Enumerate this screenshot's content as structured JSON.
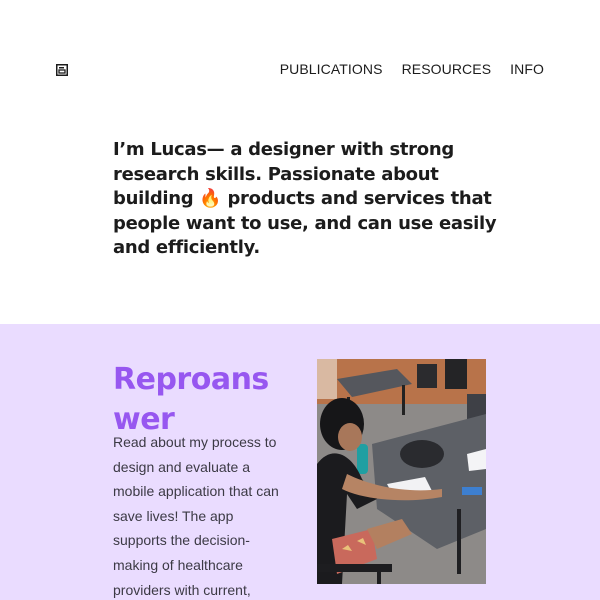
{
  "header": {
    "logo_icon": "square-logo-icon",
    "nav": [
      {
        "label": "PUBLICATIONS"
      },
      {
        "label": "RESOURCES"
      },
      {
        "label": "INFO"
      }
    ]
  },
  "intro": {
    "text_before": "I’m Lucas— a designer with strong research skills. Passionate about building ",
    "emoji": "🔥",
    "text_after": " products and services that people want to use, and can use easily and efficiently."
  },
  "project": {
    "title": "Reproanswer",
    "description": "Read about my process to design and evaluate a mobile application that can save lives! The app supports the decision-making of healthcare providers with current,",
    "image_icon": "project-photo-image",
    "colors": {
      "background": "#eadcff",
      "title": "#9757f0"
    }
  }
}
